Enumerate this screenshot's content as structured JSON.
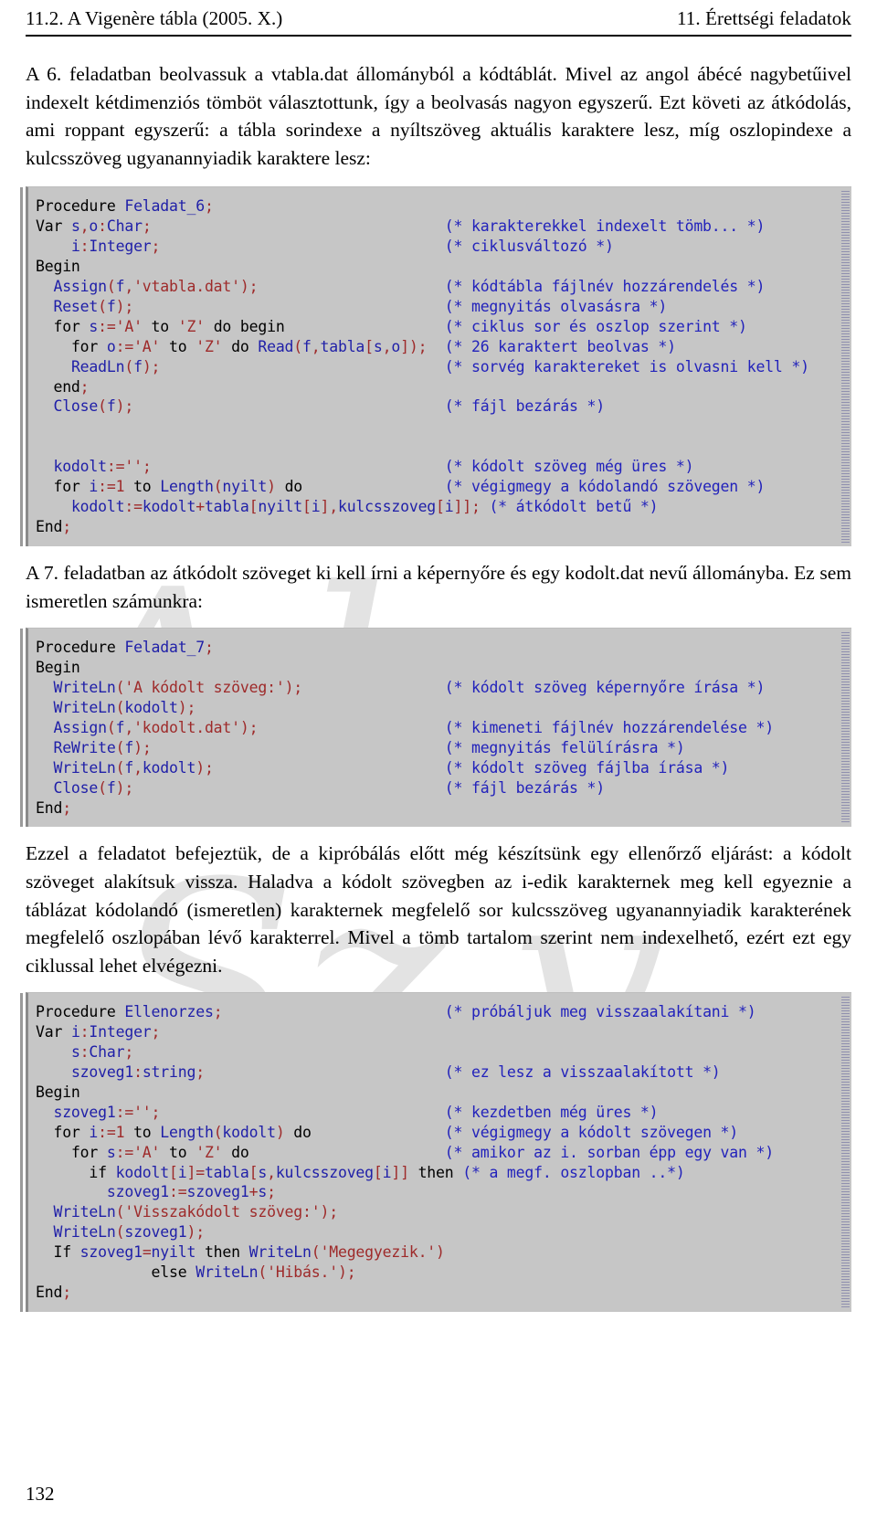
{
  "header": {
    "left": "11.2. A Vigenère tábla (2005. X.)",
    "right": "11. Érettségi feladatok"
  },
  "paragraphs": {
    "intro": "A 6. feladatban beolvassuk a vtabla.dat állományból a kódtáblát. Mivel az angol ábécé nagybetűivel indexelt kétdimenziós tömböt választottunk, így a beolvasás nagyon egyszerű. Ezt követi az átkódolás, ami roppant egyszerű: a tábla sorindexe a nyíltszöveg aktuális karaktere lesz, míg oszlopindexe a kulcsszöveg ugyanannyiadik karaktere lesz:",
    "task7": "A 7. feladatban az átkódolt szöveget ki kell írni a képernyőre és egy kodolt.dat nevű állományba. Ez sem ismeretlen számunkra:",
    "check": "Ezzel a feladatot befejeztük, de a kipróbálás előtt még készítsünk egy ellenőrző eljárást: a kódolt szöveget alakítsuk vissza. Haladva a kódolt szövegben az i-edik karakternek meg kell egyeznie a táblázat kódolandó (ismeretlen) karakternek megfelelő sor kulcsszöveg ugyanannyiadik karakterének megfelelő oszlopában lévő karakterrel. Mivel a tömb tartalom szerint nem indexelhető, ezért ezt egy ciklussal lehet elvégezni."
  },
  "code_blocks": [
    {
      "name": "feladat-6",
      "lines": [
        {
          "code": "Procedure Feladat_6;",
          "comment": ""
        },
        {
          "code": "Var s,o:Char;",
          "comment": "(* karakterekkel indexelt tömb... *)"
        },
        {
          "code": "    i:Integer;",
          "comment": "(* ciklusváltozó *)"
        },
        {
          "code": "Begin",
          "comment": ""
        },
        {
          "code": "  Assign(f,'vtabla.dat');",
          "comment": "(* kódtábla fájlnév hozzárendelés *)"
        },
        {
          "code": "  Reset(f);",
          "comment": "(* megnyitás olvasásra *)"
        },
        {
          "code": "  for s:='A' to 'Z' do begin",
          "comment": "(* ciklus sor és oszlop szerint *)"
        },
        {
          "code": "    for o:='A' to 'Z' do Read(f,tabla[s,o]);",
          "comment": "(* 26 karaktert beolvas *)"
        },
        {
          "code": "    ReadLn(f);",
          "comment": "(* sorvég karaktereket is olvasni kell *)"
        },
        {
          "code": "  end;",
          "comment": ""
        },
        {
          "code": "  Close(f);",
          "comment": "(* fájl bezárás *)"
        },
        {
          "code": "",
          "comment": ""
        },
        {
          "code": "",
          "comment": ""
        },
        {
          "code": "  kodolt:='';",
          "comment": "(* kódolt szöveg még üres *)"
        },
        {
          "code": "  for i:=1 to Length(nyilt) do",
          "comment": "(* végigmegy a kódolandó szövegen *)"
        },
        {
          "code": "    kodolt:=kodolt+tabla[nyilt[i],kulcsszoveg[i]];",
          "comment": "(* átkódolt betű *)"
        },
        {
          "code": "End;",
          "comment": ""
        }
      ]
    },
    {
      "name": "feladat-7",
      "lines": [
        {
          "code": "Procedure Feladat_7;",
          "comment": ""
        },
        {
          "code": "Begin",
          "comment": ""
        },
        {
          "code": "  WriteLn('A kódolt szöveg:');",
          "comment": "(* kódolt szöveg képernyőre írása *)"
        },
        {
          "code": "  WriteLn(kodolt);",
          "comment": ""
        },
        {
          "code": "  Assign(f,'kodolt.dat');",
          "comment": "(* kimeneti fájlnév hozzárendelése *)"
        },
        {
          "code": "  ReWrite(f);",
          "comment": "(* megnyitás felülírásra *)"
        },
        {
          "code": "  WriteLn(f,kodolt);",
          "comment": "(* kódolt szöveg fájlba írása *)"
        },
        {
          "code": "  Close(f);",
          "comment": "(* fájl bezárás *)"
        },
        {
          "code": "End;",
          "comment": ""
        }
      ]
    },
    {
      "name": "ellenorzes",
      "lines": [
        {
          "code": "Procedure Ellenorzes;",
          "comment": "(* próbáljuk meg visszaalakítani *)"
        },
        {
          "code": "Var i:Integer;",
          "comment": ""
        },
        {
          "code": "    s:Char;",
          "comment": ""
        },
        {
          "code": "    szoveg1:string;",
          "comment": "(* ez lesz a visszaalakított *)"
        },
        {
          "code": "Begin",
          "comment": ""
        },
        {
          "code": "  szoveg1:='';",
          "comment": "(* kezdetben még üres *)"
        },
        {
          "code": "  for i:=1 to Length(kodolt) do",
          "comment": "(* végigmegy a kódolt szövegen *)"
        },
        {
          "code": "    for s:='A' to 'Z' do",
          "comment": "(* amikor az i. sorban épp egy van *)"
        },
        {
          "code": "      if kodolt[i]=tabla[s,kulcsszoveg[i]] then",
          "comment": "(* a megf. oszlopban ..*)"
        },
        {
          "code": "        szoveg1:=szoveg1+s;",
          "comment": ""
        },
        {
          "code": "  WriteLn('Visszakódolt szöveg:');",
          "comment": ""
        },
        {
          "code": "  WriteLn(szoveg1);",
          "comment": ""
        },
        {
          "code": "  If szoveg1=nyilt then WriteLn('Megegyezik.')",
          "comment": ""
        },
        {
          "code": "             else WriteLn('Hibás.');",
          "comment": ""
        },
        {
          "code": "End;",
          "comment": ""
        }
      ]
    }
  ],
  "footer": {
    "page_number": "132"
  },
  "colors": {
    "code_background": "#c6c6c6",
    "identifier": "#1f1fa8",
    "literal": "#9e2a2a",
    "comment": "#2222bb",
    "page_background": "#ffffff",
    "text": "#000000"
  }
}
